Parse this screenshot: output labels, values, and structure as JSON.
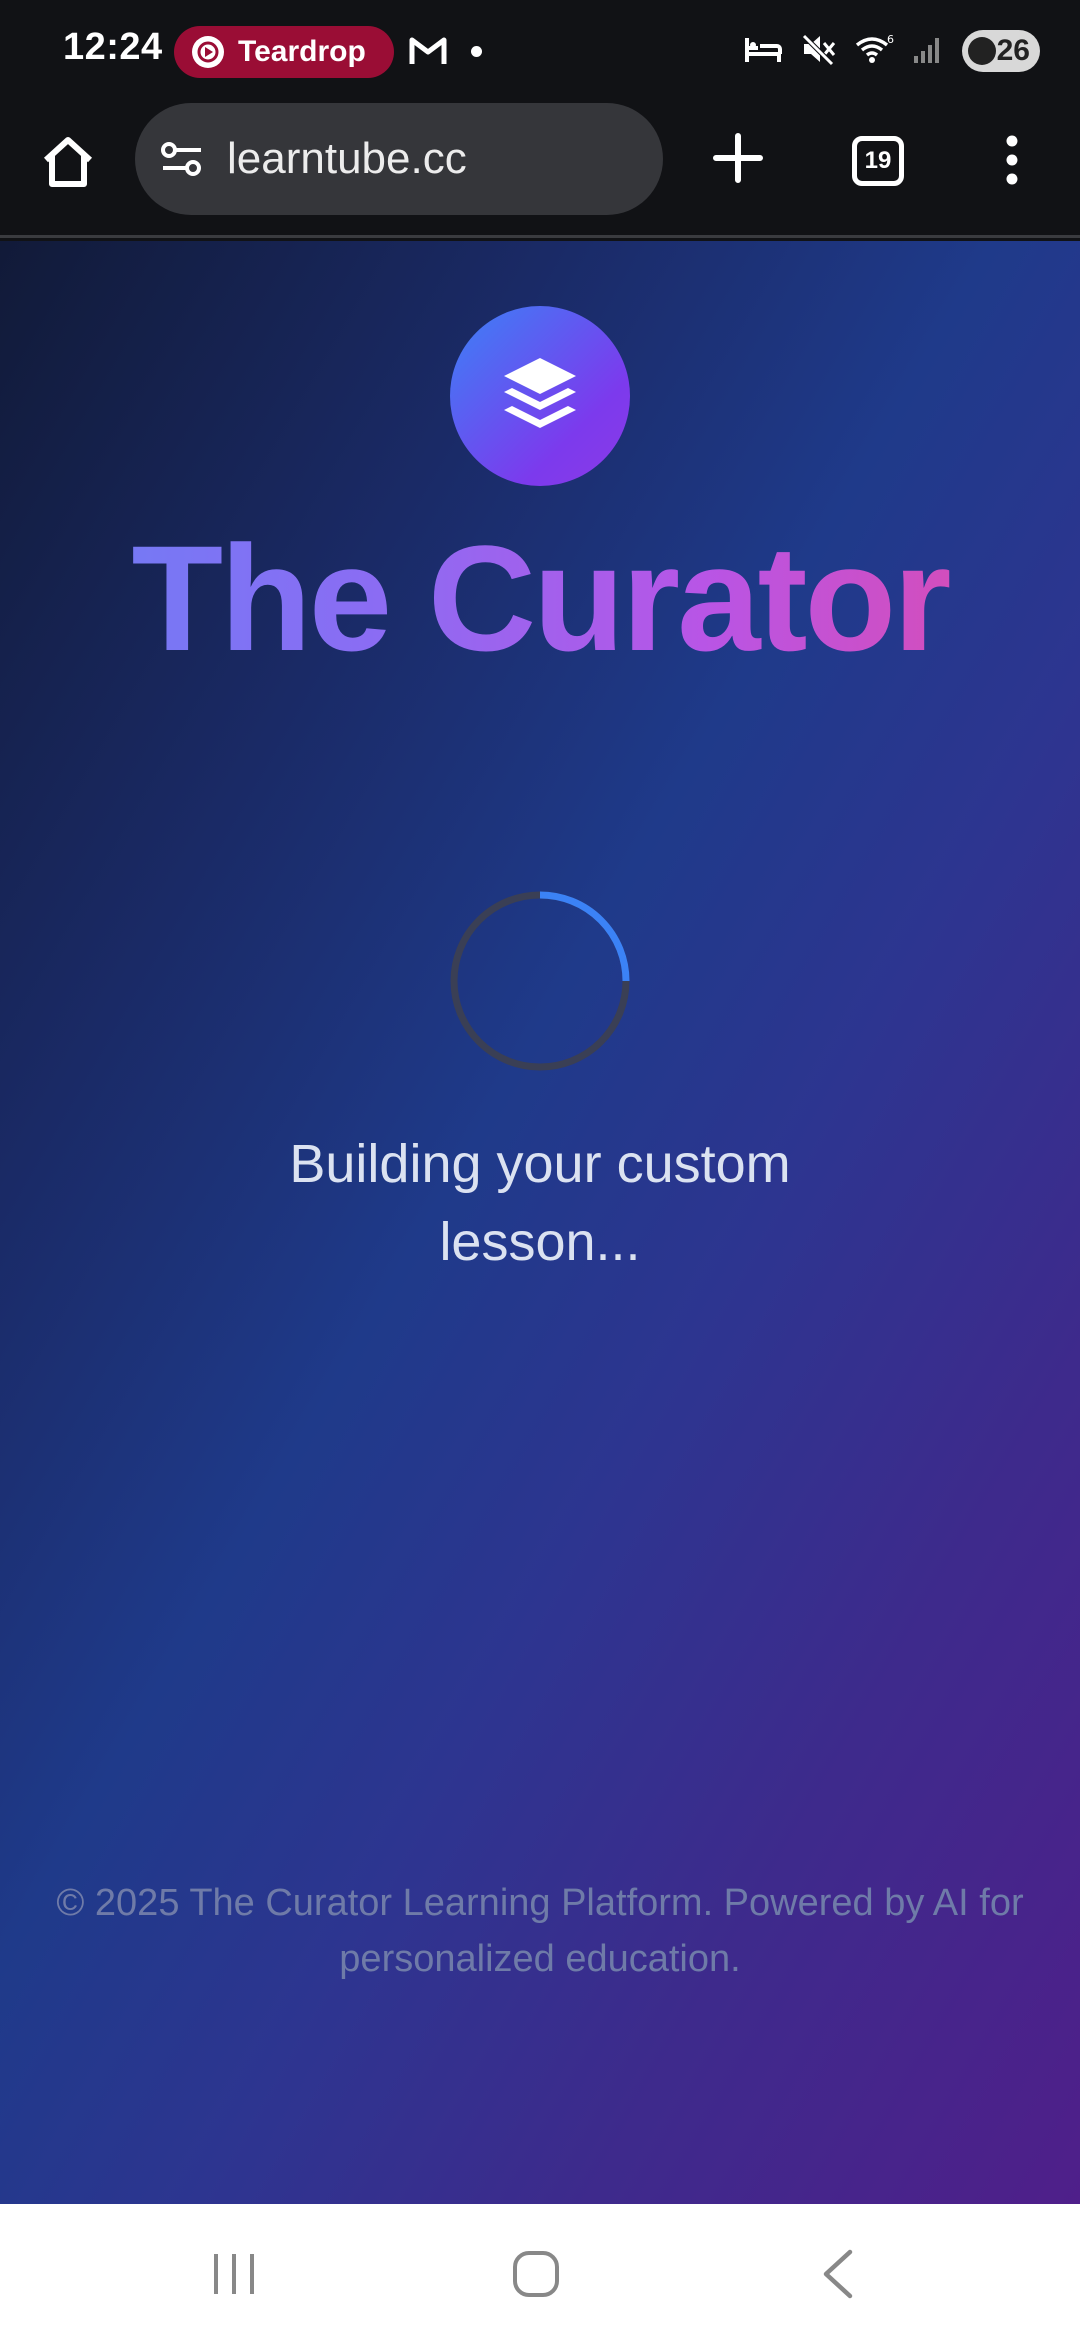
{
  "status_bar": {
    "time": "12:24",
    "notification_app": "Teardrop",
    "battery": "26",
    "icons": [
      "gmail-icon",
      "dot-icon",
      "sleep-mode-icon",
      "mute-icon",
      "wifi-6-icon",
      "signal-icon",
      "battery-saver-icon"
    ]
  },
  "browser": {
    "url": "learntube.cc",
    "tab_count": "19",
    "icons": [
      "home-icon",
      "site-settings-icon",
      "new-tab-icon",
      "tabs-icon",
      "more-menu-icon"
    ]
  },
  "page": {
    "logo_icon": "layers-icon",
    "title": "The Curator",
    "loading_message": "Building your custom lesson...",
    "footer": "© 2025 The Curator Learning Platform. Powered by AI for personalized education."
  },
  "colors": {
    "accent_blue": "#3b82f6",
    "accent_purple": "#7c3aed",
    "accent_pink": "#e04aa8",
    "spinner_track": "#3a3f55",
    "spinner_arc": "#3b82f6"
  },
  "navigation_bar": {
    "icons": [
      "recents-icon",
      "home-nav-icon",
      "back-icon"
    ]
  }
}
